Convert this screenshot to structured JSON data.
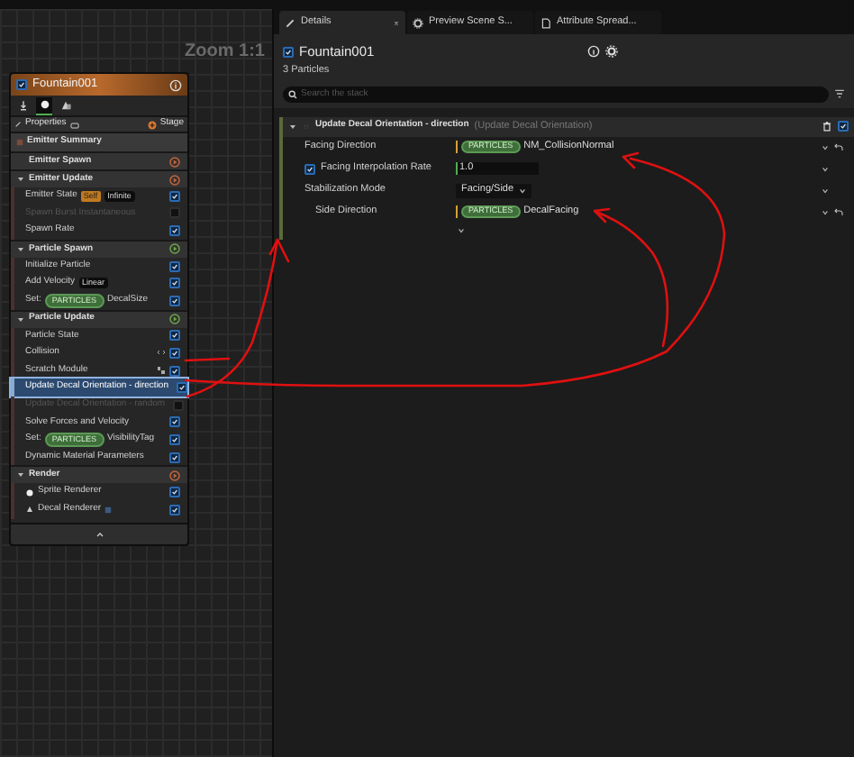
{
  "graph": {
    "zoom_label": "Zoom 1:1"
  },
  "emitter_node": {
    "title": "Fountain001",
    "checked": true,
    "properties_label": "Properties",
    "stage_label": "Stage",
    "rows": [
      {
        "kind": "summary",
        "label": "Emitter Summary"
      },
      {
        "kind": "group",
        "label": "Emitter Spawn",
        "expanded": false,
        "color": "#c8663a"
      },
      {
        "kind": "group",
        "label": "Emitter Update",
        "expanded": true,
        "color": "#c8663a"
      },
      {
        "kind": "item",
        "label": "Emitter State",
        "tags": [
          {
            "kind": "self",
            "text": "Self"
          },
          {
            "kind": "value",
            "text": "Infinite"
          }
        ],
        "checked": true,
        "disabled": false,
        "selected": false
      },
      {
        "kind": "item",
        "label": "Spawn Burst Instantaneous",
        "checked": false,
        "disabled": true,
        "selected": false
      },
      {
        "kind": "item",
        "label": "Spawn Rate",
        "checked": true,
        "disabled": false,
        "selected": false
      },
      {
        "kind": "group",
        "label": "Particle Spawn",
        "expanded": true,
        "color": "#6fa84a"
      },
      {
        "kind": "item",
        "label": "Initialize Particle",
        "checked": true,
        "disabled": false,
        "selected": false
      },
      {
        "kind": "item",
        "label": "Add Velocity",
        "tags": [
          {
            "kind": "value",
            "text": "Linear"
          }
        ],
        "checked": true,
        "disabled": false,
        "selected": false
      },
      {
        "kind": "item",
        "label": "Set:",
        "tags": [
          {
            "kind": "particles",
            "text": "PARTICLES"
          }
        ],
        "suffix": "DecalSize",
        "checked": true,
        "disabled": false,
        "selected": false
      },
      {
        "kind": "group",
        "label": "Particle Update",
        "expanded": true,
        "color": "#6fa84a"
      },
      {
        "kind": "item",
        "label": "Particle State",
        "checked": true,
        "disabled": false,
        "selected": false
      },
      {
        "kind": "coded",
        "label": "Collision",
        "checked": true,
        "disabled": false,
        "selected": false
      },
      {
        "kind": "scratch",
        "label": "Scratch Module",
        "checked": true,
        "disabled": false,
        "selected": false
      },
      {
        "kind": "item",
        "label": "Update Decal Orientation - direction",
        "checked": true,
        "disabled": false,
        "selected": true
      },
      {
        "kind": "item",
        "label": "Update Decal Orientation - random",
        "checked": false,
        "disabled": true,
        "selected": false
      },
      {
        "kind": "item",
        "label": "Solve Forces and Velocity",
        "checked": true,
        "disabled": false,
        "selected": false
      },
      {
        "kind": "item",
        "label": "Set:",
        "tags": [
          {
            "kind": "particles",
            "text": "PARTICLES"
          }
        ],
        "suffix": "VisibilityTag",
        "checked": true,
        "disabled": false,
        "selected": false
      },
      {
        "kind": "item",
        "label": "Dynamic Material Parameters",
        "checked": true,
        "disabled": false,
        "selected": false
      },
      {
        "kind": "group",
        "label": "Render",
        "expanded": true,
        "color": "#c8663a"
      },
      {
        "kind": "sprite",
        "label": "Sprite Renderer",
        "checked": true,
        "disabled": false,
        "selected": false
      },
      {
        "kind": "decal",
        "label": "Decal Renderer",
        "checked": true,
        "disabled": false,
        "selected": false
      }
    ]
  },
  "details": {
    "tabs": [
      {
        "label": "Details",
        "selected": true
      },
      {
        "label": "Preview Scene S...",
        "selected": false
      },
      {
        "label": "Attribute Spread...",
        "selected": false
      }
    ],
    "emitter": {
      "title": "Fountain001",
      "checked": true,
      "subtitle": "3 Particles"
    },
    "search": {
      "placeholder": "Search the stack"
    },
    "module": {
      "title": "Update Decal Orientation - direction",
      "subtitle": "(Update Decal Orientation)",
      "expanded": true,
      "checked": true
    },
    "params": [
      {
        "kind": "binding",
        "label": "Facing Direction",
        "namespace": "PARTICLES",
        "value": "NM_CollisionNormal"
      },
      {
        "kind": "number",
        "label": "Facing Interpolation Rate",
        "checked": true,
        "value": "1.0"
      },
      {
        "kind": "dropdown",
        "label": "Stabilization Mode",
        "value": "Facing/Side",
        "children": [
          {
            "kind": "binding",
            "label": "Side Direction",
            "namespace": "PARTICLES",
            "value": "DecalFacing"
          }
        ]
      }
    ]
  }
}
